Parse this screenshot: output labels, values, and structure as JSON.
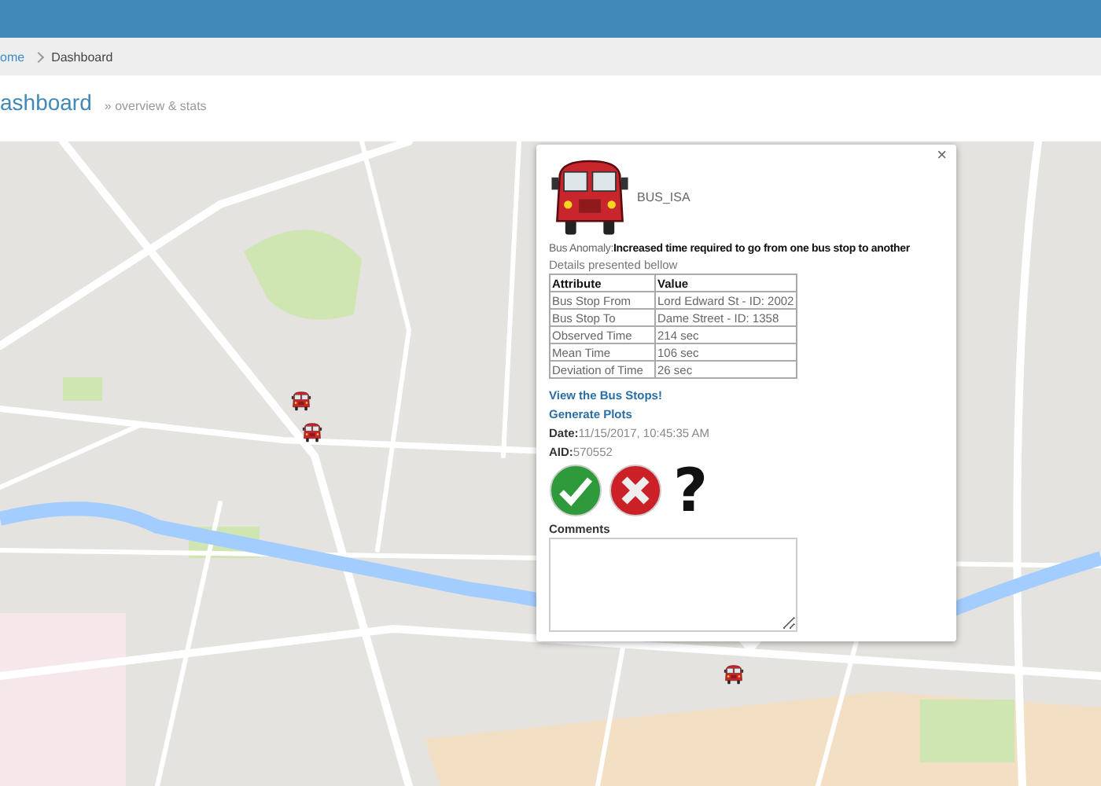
{
  "breadcrumb": [
    {
      "label": "ome",
      "kind": "link"
    },
    {
      "label": "Dashboard",
      "kind": "current"
    }
  ],
  "page_title": {
    "title": "ashboard",
    "subtitle": "» overview & stats"
  },
  "popup": {
    "close": "×",
    "vehicle": "BUS_ISA",
    "anomaly": "Bus Anomaly:**Increased time required to go from one bus stop to another**",
    "details": "Details presented bellow",
    "table": {
      "columns": [
        "Attribute",
        "Value"
      ],
      "rows": [
        [
          "Bus Stop From",
          "Lord Edward St - ID: 2002"
        ],
        [
          "Bus Stop To",
          "Dame Street - ID: 1358"
        ],
        [
          "Observed Time",
          "214 sec"
        ],
        [
          "Mean Time",
          "106 sec"
        ],
        [
          "Deviation of Time",
          "26 sec"
        ]
      ]
    },
    "links": [
      "View the Bus Stops!",
      "Generate Plots"
    ],
    "fields": [
      {
        "label": "Date:",
        "value": "11/15/2017, 10:45:35 AM"
      },
      {
        "label": "AID:",
        "value": "570552"
      }
    ],
    "actions": [
      {
        "kind": "accept"
      },
      {
        "kind": "reject"
      },
      {
        "kind": "unknown",
        "glyph": "?"
      }
    ],
    "comments": {
      "label": "Comments"
    }
  }
}
